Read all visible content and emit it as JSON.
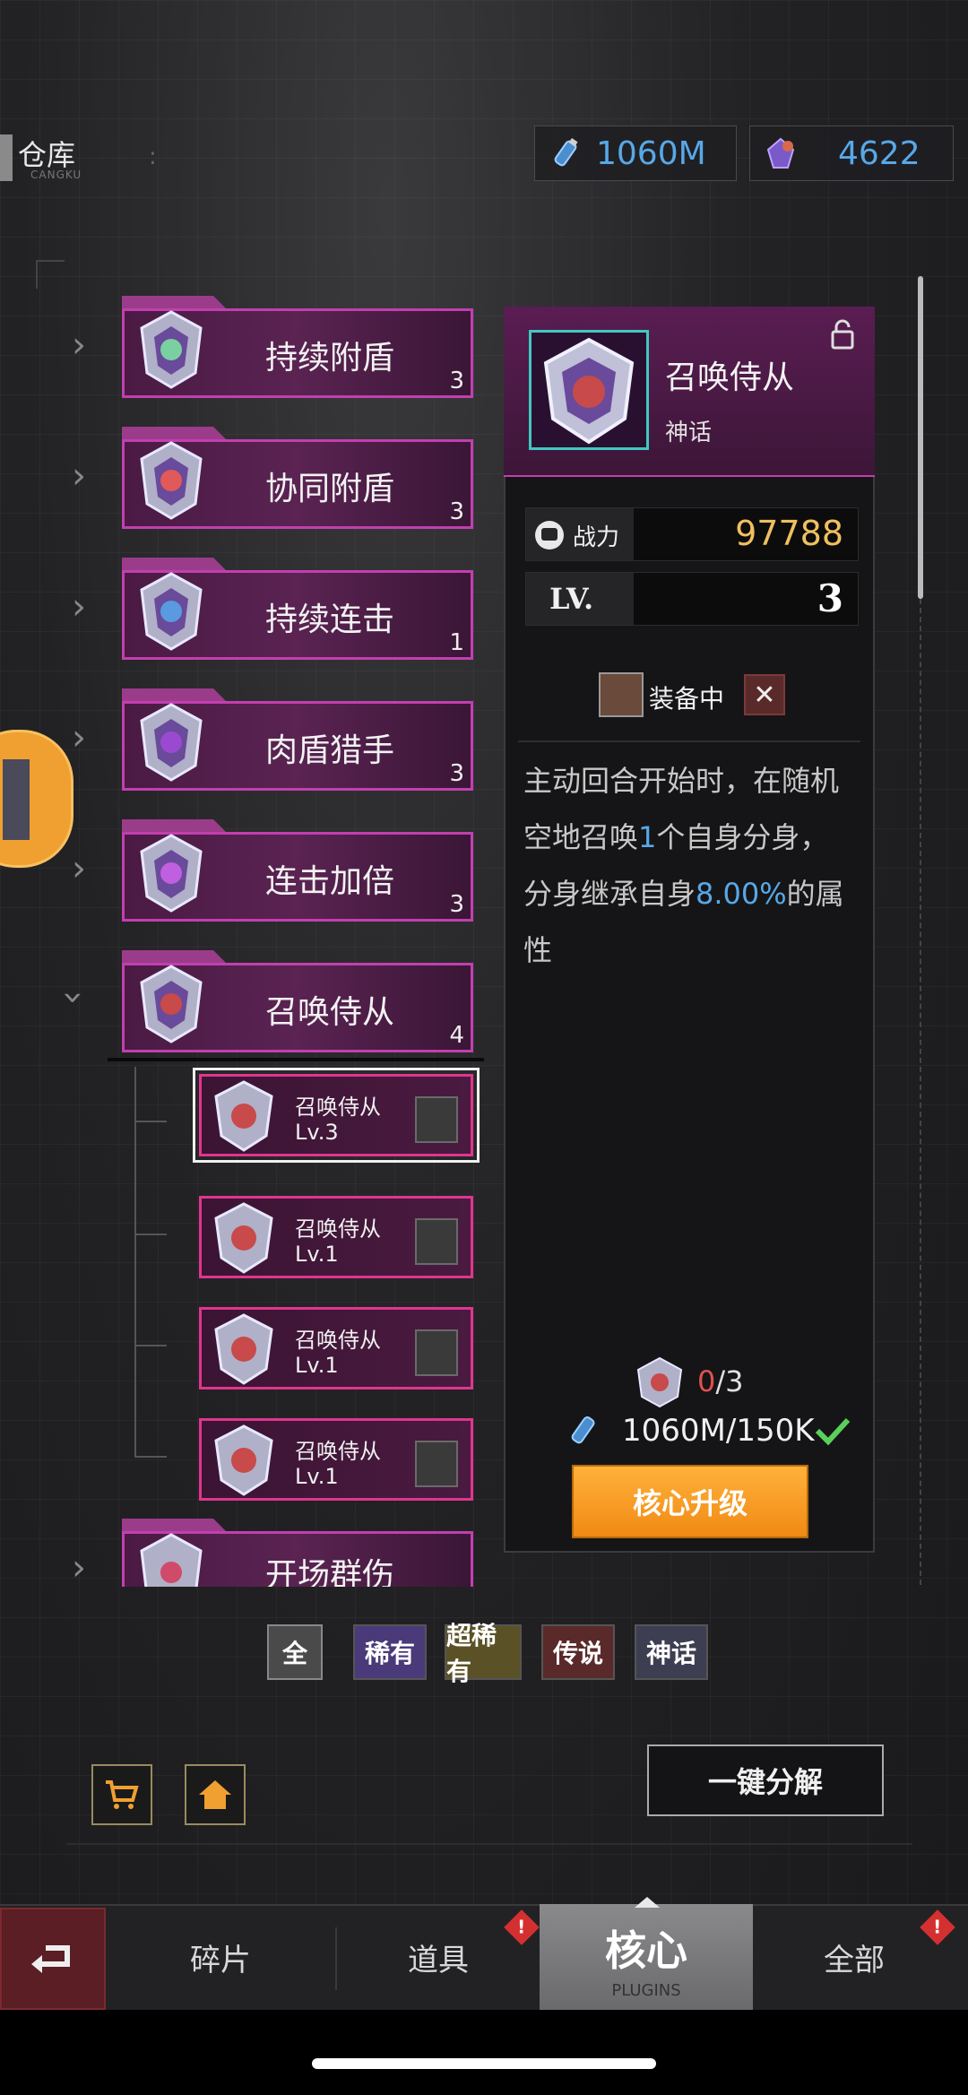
{
  "header": {
    "title": "仓库",
    "title_sub": "CANGKU",
    "energy_value": "1060M",
    "gem_value": "4622"
  },
  "plugin_list": [
    {
      "label": "持续附盾",
      "count": "3",
      "expanded": false
    },
    {
      "label": "协同附盾",
      "count": "3",
      "expanded": false
    },
    {
      "label": "持续连击",
      "count": "1",
      "expanded": false
    },
    {
      "label": "肉盾猎手",
      "count": "3",
      "expanded": false
    },
    {
      "label": "连击加倍",
      "count": "3",
      "expanded": false
    },
    {
      "label": "召唤侍从",
      "count": "4",
      "expanded": true
    },
    {
      "label": "开场群伤",
      "count": "",
      "expanded": false
    }
  ],
  "sub_items": [
    {
      "name": "召唤侍从",
      "level": "Lv.3",
      "selected": true
    },
    {
      "name": "召唤侍从",
      "level": "Lv.1",
      "selected": false
    },
    {
      "name": "召唤侍从",
      "level": "Lv.1",
      "selected": false
    },
    {
      "name": "召唤侍从",
      "level": "Lv.1",
      "selected": false
    }
  ],
  "detail": {
    "name": "召唤侍从",
    "rarity": "神话",
    "power_label": "战力",
    "power_value": "97788",
    "level_label": "LV.",
    "level_value": "3",
    "equipped_label": "装备中",
    "desc_part1": "主动回合开始时，在随机空地召唤",
    "desc_num1": "1",
    "desc_part2": "个自身分身，分身继承自身",
    "desc_num2": "8.00%",
    "desc_part3": "的属性",
    "material_have": "0",
    "material_need": "/3",
    "cost_text": "1060M/150K",
    "upgrade_label": "核心升级"
  },
  "filters": [
    {
      "label": "全",
      "color": "#4a4a4a"
    },
    {
      "label": "稀有",
      "color": "#4a3a7a"
    },
    {
      "label": "超稀有",
      "color": "#5a5226"
    },
    {
      "label": "传说",
      "color": "#5a2a2a"
    },
    {
      "label": "神话",
      "color": "#3e3e52"
    }
  ],
  "dismantle_label": "一键分解",
  "nav": {
    "fragments": "碎片",
    "items": "道具",
    "core": "核心",
    "core_sub": "PLUGINS",
    "all": "全部",
    "badge": "!"
  },
  "colors": {
    "accent_magenta": "#c23fb0",
    "blue_value": "#58a8e8",
    "gold_value": "#f0c060",
    "upgrade_orange": "#f59a1e"
  }
}
